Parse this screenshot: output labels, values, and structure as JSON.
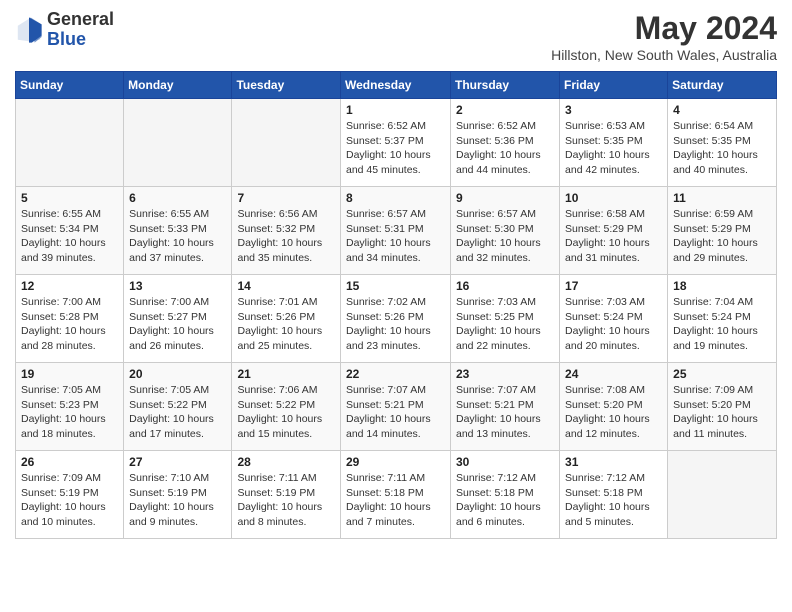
{
  "header": {
    "logo_general": "General",
    "logo_blue": "Blue",
    "month": "May 2024",
    "location": "Hillston, New South Wales, Australia"
  },
  "days_of_week": [
    "Sunday",
    "Monday",
    "Tuesday",
    "Wednesday",
    "Thursday",
    "Friday",
    "Saturday"
  ],
  "weeks": [
    [
      {
        "day": "",
        "info": ""
      },
      {
        "day": "",
        "info": ""
      },
      {
        "day": "",
        "info": ""
      },
      {
        "day": "1",
        "info": "Sunrise: 6:52 AM\nSunset: 5:37 PM\nDaylight: 10 hours\nand 45 minutes."
      },
      {
        "day": "2",
        "info": "Sunrise: 6:52 AM\nSunset: 5:36 PM\nDaylight: 10 hours\nand 44 minutes."
      },
      {
        "day": "3",
        "info": "Sunrise: 6:53 AM\nSunset: 5:35 PM\nDaylight: 10 hours\nand 42 minutes."
      },
      {
        "day": "4",
        "info": "Sunrise: 6:54 AM\nSunset: 5:35 PM\nDaylight: 10 hours\nand 40 minutes."
      }
    ],
    [
      {
        "day": "5",
        "info": "Sunrise: 6:55 AM\nSunset: 5:34 PM\nDaylight: 10 hours\nand 39 minutes."
      },
      {
        "day": "6",
        "info": "Sunrise: 6:55 AM\nSunset: 5:33 PM\nDaylight: 10 hours\nand 37 minutes."
      },
      {
        "day": "7",
        "info": "Sunrise: 6:56 AM\nSunset: 5:32 PM\nDaylight: 10 hours\nand 35 minutes."
      },
      {
        "day": "8",
        "info": "Sunrise: 6:57 AM\nSunset: 5:31 PM\nDaylight: 10 hours\nand 34 minutes."
      },
      {
        "day": "9",
        "info": "Sunrise: 6:57 AM\nSunset: 5:30 PM\nDaylight: 10 hours\nand 32 minutes."
      },
      {
        "day": "10",
        "info": "Sunrise: 6:58 AM\nSunset: 5:29 PM\nDaylight: 10 hours\nand 31 minutes."
      },
      {
        "day": "11",
        "info": "Sunrise: 6:59 AM\nSunset: 5:29 PM\nDaylight: 10 hours\nand 29 minutes."
      }
    ],
    [
      {
        "day": "12",
        "info": "Sunrise: 7:00 AM\nSunset: 5:28 PM\nDaylight: 10 hours\nand 28 minutes."
      },
      {
        "day": "13",
        "info": "Sunrise: 7:00 AM\nSunset: 5:27 PM\nDaylight: 10 hours\nand 26 minutes."
      },
      {
        "day": "14",
        "info": "Sunrise: 7:01 AM\nSunset: 5:26 PM\nDaylight: 10 hours\nand 25 minutes."
      },
      {
        "day": "15",
        "info": "Sunrise: 7:02 AM\nSunset: 5:26 PM\nDaylight: 10 hours\nand 23 minutes."
      },
      {
        "day": "16",
        "info": "Sunrise: 7:03 AM\nSunset: 5:25 PM\nDaylight: 10 hours\nand 22 minutes."
      },
      {
        "day": "17",
        "info": "Sunrise: 7:03 AM\nSunset: 5:24 PM\nDaylight: 10 hours\nand 20 minutes."
      },
      {
        "day": "18",
        "info": "Sunrise: 7:04 AM\nSunset: 5:24 PM\nDaylight: 10 hours\nand 19 minutes."
      }
    ],
    [
      {
        "day": "19",
        "info": "Sunrise: 7:05 AM\nSunset: 5:23 PM\nDaylight: 10 hours\nand 18 minutes."
      },
      {
        "day": "20",
        "info": "Sunrise: 7:05 AM\nSunset: 5:22 PM\nDaylight: 10 hours\nand 17 minutes."
      },
      {
        "day": "21",
        "info": "Sunrise: 7:06 AM\nSunset: 5:22 PM\nDaylight: 10 hours\nand 15 minutes."
      },
      {
        "day": "22",
        "info": "Sunrise: 7:07 AM\nSunset: 5:21 PM\nDaylight: 10 hours\nand 14 minutes."
      },
      {
        "day": "23",
        "info": "Sunrise: 7:07 AM\nSunset: 5:21 PM\nDaylight: 10 hours\nand 13 minutes."
      },
      {
        "day": "24",
        "info": "Sunrise: 7:08 AM\nSunset: 5:20 PM\nDaylight: 10 hours\nand 12 minutes."
      },
      {
        "day": "25",
        "info": "Sunrise: 7:09 AM\nSunset: 5:20 PM\nDaylight: 10 hours\nand 11 minutes."
      }
    ],
    [
      {
        "day": "26",
        "info": "Sunrise: 7:09 AM\nSunset: 5:19 PM\nDaylight: 10 hours\nand 10 minutes."
      },
      {
        "day": "27",
        "info": "Sunrise: 7:10 AM\nSunset: 5:19 PM\nDaylight: 10 hours\nand 9 minutes."
      },
      {
        "day": "28",
        "info": "Sunrise: 7:11 AM\nSunset: 5:19 PM\nDaylight: 10 hours\nand 8 minutes."
      },
      {
        "day": "29",
        "info": "Sunrise: 7:11 AM\nSunset: 5:18 PM\nDaylight: 10 hours\nand 7 minutes."
      },
      {
        "day": "30",
        "info": "Sunrise: 7:12 AM\nSunset: 5:18 PM\nDaylight: 10 hours\nand 6 minutes."
      },
      {
        "day": "31",
        "info": "Sunrise: 7:12 AM\nSunset: 5:18 PM\nDaylight: 10 hours\nand 5 minutes."
      },
      {
        "day": "",
        "info": ""
      }
    ]
  ]
}
